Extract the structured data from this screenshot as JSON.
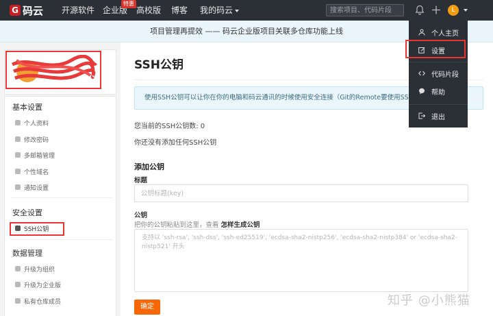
{
  "brand": {
    "name": "码云",
    "mark": "G",
    "accent": "#c71d23"
  },
  "nav": {
    "items": [
      {
        "label": "开源软件"
      },
      {
        "label": "企业版"
      },
      {
        "label": "高校版"
      },
      {
        "label": "博客"
      },
      {
        "label": "我的码云"
      }
    ],
    "badge": "特惠",
    "search_placeholder": "搜索项目、代码片段",
    "avatar_letter": "L"
  },
  "announcement": "项目管理再提效 —— 码云企业版项目关联多仓库功能上线",
  "sidebar": {
    "sections": [
      {
        "title": "基本设置",
        "items": [
          "个人资料",
          "修改密码",
          "多邮箱管理",
          "个性域名",
          "通知设置"
        ]
      },
      {
        "title": "安全设置",
        "items": [
          "SSH公钥"
        ]
      },
      {
        "title": "数据管理",
        "items": [
          "升级为组织",
          "升级为企业版",
          "私有仓库成员"
        ]
      }
    ],
    "active_item": "SSH公钥"
  },
  "main": {
    "title": "SSH公钥",
    "info": "使用SSH公钥可以让你在你的电脑和码云通讯的时候使用安全连接（Git的Remote要使用SSH地",
    "count_text": "您当前的SSH公钥数: 0",
    "none_text": "你还没有添加任何SSH公钥",
    "add_title": "添加公钥",
    "title_label": "标题",
    "title_placeholder": "公钥标题(key)",
    "key_label": "公钥",
    "hint_prefix": "把你的公钥粘贴到这里，查看",
    "hint_link": "怎样生成公钥",
    "key_placeholder": "支持以 'ssh-rsa', 'ssh-dss', 'ssh-ed25519', 'ecdsa-sha2-nistp256', 'ecdsa-sha2-nistp384' or 'ecdsa-sha2-nistp521' 开头",
    "submit_label": "确定"
  },
  "dropdown": {
    "items": [
      {
        "label": "个人主页",
        "icon": "user-icon"
      },
      {
        "label": "设置",
        "icon": "edit-icon"
      },
      {
        "label": "代码片段",
        "icon": "code-icon"
      },
      {
        "label": "帮助",
        "icon": "help-icon"
      },
      {
        "label": "退出",
        "icon": "logout-icon"
      }
    ]
  },
  "watermark": "知乎 @小熊猫",
  "colors": {
    "nav_bg": "#2b2f36",
    "primary_button": "#f76707",
    "highlight": "#ee3333"
  }
}
